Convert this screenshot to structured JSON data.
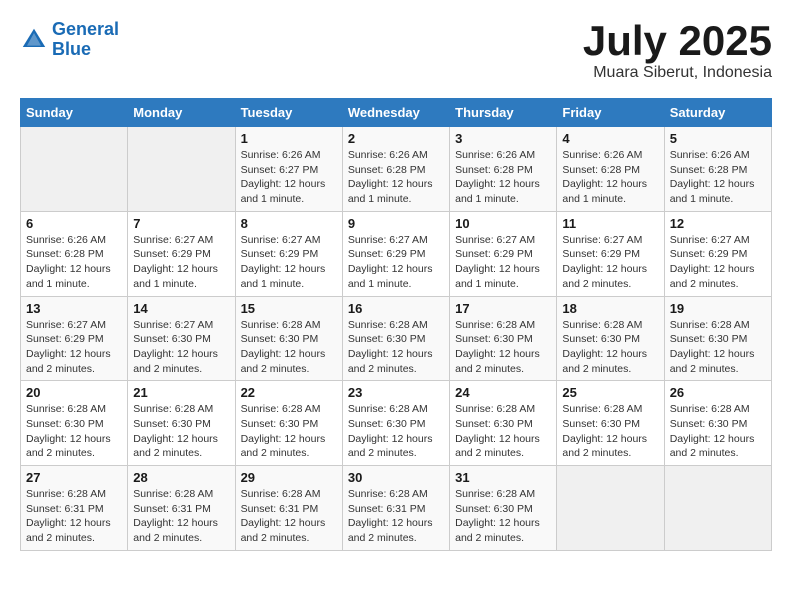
{
  "header": {
    "logo_line1": "General",
    "logo_line2": "Blue",
    "month": "July 2025",
    "location": "Muara Siberut, Indonesia"
  },
  "weekdays": [
    "Sunday",
    "Monday",
    "Tuesday",
    "Wednesday",
    "Thursday",
    "Friday",
    "Saturday"
  ],
  "weeks": [
    [
      {
        "day": "",
        "info": ""
      },
      {
        "day": "",
        "info": ""
      },
      {
        "day": "1",
        "info": "Sunrise: 6:26 AM\nSunset: 6:27 PM\nDaylight: 12 hours and 1 minute."
      },
      {
        "day": "2",
        "info": "Sunrise: 6:26 AM\nSunset: 6:28 PM\nDaylight: 12 hours and 1 minute."
      },
      {
        "day": "3",
        "info": "Sunrise: 6:26 AM\nSunset: 6:28 PM\nDaylight: 12 hours and 1 minute."
      },
      {
        "day": "4",
        "info": "Sunrise: 6:26 AM\nSunset: 6:28 PM\nDaylight: 12 hours and 1 minute."
      },
      {
        "day": "5",
        "info": "Sunrise: 6:26 AM\nSunset: 6:28 PM\nDaylight: 12 hours and 1 minute."
      }
    ],
    [
      {
        "day": "6",
        "info": "Sunrise: 6:26 AM\nSunset: 6:28 PM\nDaylight: 12 hours and 1 minute."
      },
      {
        "day": "7",
        "info": "Sunrise: 6:27 AM\nSunset: 6:29 PM\nDaylight: 12 hours and 1 minute."
      },
      {
        "day": "8",
        "info": "Sunrise: 6:27 AM\nSunset: 6:29 PM\nDaylight: 12 hours and 1 minute."
      },
      {
        "day": "9",
        "info": "Sunrise: 6:27 AM\nSunset: 6:29 PM\nDaylight: 12 hours and 1 minute."
      },
      {
        "day": "10",
        "info": "Sunrise: 6:27 AM\nSunset: 6:29 PM\nDaylight: 12 hours and 1 minute."
      },
      {
        "day": "11",
        "info": "Sunrise: 6:27 AM\nSunset: 6:29 PM\nDaylight: 12 hours and 2 minutes."
      },
      {
        "day": "12",
        "info": "Sunrise: 6:27 AM\nSunset: 6:29 PM\nDaylight: 12 hours and 2 minutes."
      }
    ],
    [
      {
        "day": "13",
        "info": "Sunrise: 6:27 AM\nSunset: 6:29 PM\nDaylight: 12 hours and 2 minutes."
      },
      {
        "day": "14",
        "info": "Sunrise: 6:27 AM\nSunset: 6:30 PM\nDaylight: 12 hours and 2 minutes."
      },
      {
        "day": "15",
        "info": "Sunrise: 6:28 AM\nSunset: 6:30 PM\nDaylight: 12 hours and 2 minutes."
      },
      {
        "day": "16",
        "info": "Sunrise: 6:28 AM\nSunset: 6:30 PM\nDaylight: 12 hours and 2 minutes."
      },
      {
        "day": "17",
        "info": "Sunrise: 6:28 AM\nSunset: 6:30 PM\nDaylight: 12 hours and 2 minutes."
      },
      {
        "day": "18",
        "info": "Sunrise: 6:28 AM\nSunset: 6:30 PM\nDaylight: 12 hours and 2 minutes."
      },
      {
        "day": "19",
        "info": "Sunrise: 6:28 AM\nSunset: 6:30 PM\nDaylight: 12 hours and 2 minutes."
      }
    ],
    [
      {
        "day": "20",
        "info": "Sunrise: 6:28 AM\nSunset: 6:30 PM\nDaylight: 12 hours and 2 minutes."
      },
      {
        "day": "21",
        "info": "Sunrise: 6:28 AM\nSunset: 6:30 PM\nDaylight: 12 hours and 2 minutes."
      },
      {
        "day": "22",
        "info": "Sunrise: 6:28 AM\nSunset: 6:30 PM\nDaylight: 12 hours and 2 minutes."
      },
      {
        "day": "23",
        "info": "Sunrise: 6:28 AM\nSunset: 6:30 PM\nDaylight: 12 hours and 2 minutes."
      },
      {
        "day": "24",
        "info": "Sunrise: 6:28 AM\nSunset: 6:30 PM\nDaylight: 12 hours and 2 minutes."
      },
      {
        "day": "25",
        "info": "Sunrise: 6:28 AM\nSunset: 6:30 PM\nDaylight: 12 hours and 2 minutes."
      },
      {
        "day": "26",
        "info": "Sunrise: 6:28 AM\nSunset: 6:30 PM\nDaylight: 12 hours and 2 minutes."
      }
    ],
    [
      {
        "day": "27",
        "info": "Sunrise: 6:28 AM\nSunset: 6:31 PM\nDaylight: 12 hours and 2 minutes."
      },
      {
        "day": "28",
        "info": "Sunrise: 6:28 AM\nSunset: 6:31 PM\nDaylight: 12 hours and 2 minutes."
      },
      {
        "day": "29",
        "info": "Sunrise: 6:28 AM\nSunset: 6:31 PM\nDaylight: 12 hours and 2 minutes."
      },
      {
        "day": "30",
        "info": "Sunrise: 6:28 AM\nSunset: 6:31 PM\nDaylight: 12 hours and 2 minutes."
      },
      {
        "day": "31",
        "info": "Sunrise: 6:28 AM\nSunset: 6:30 PM\nDaylight: 12 hours and 2 minutes."
      },
      {
        "day": "",
        "info": ""
      },
      {
        "day": "",
        "info": ""
      }
    ]
  ]
}
